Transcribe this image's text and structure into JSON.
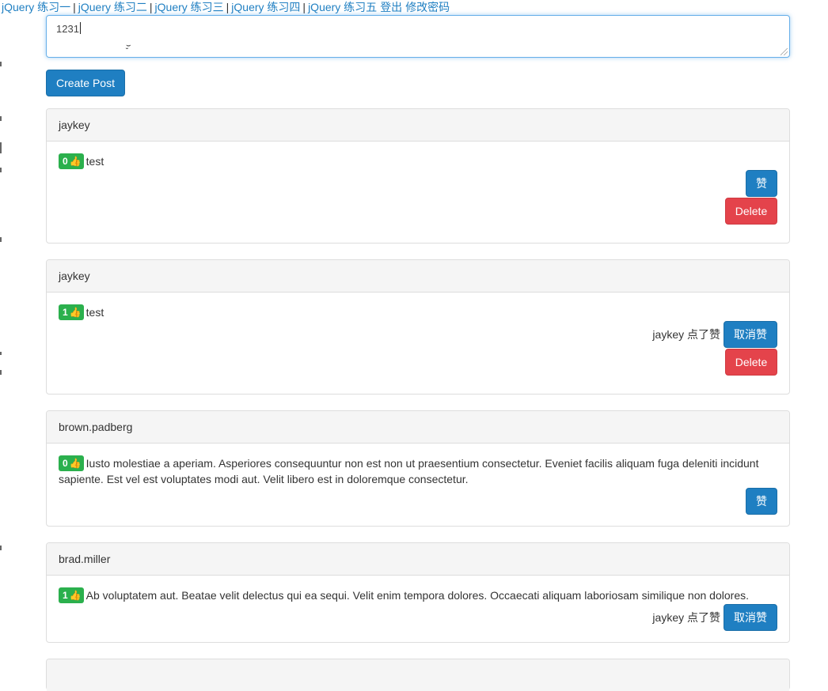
{
  "nav": {
    "links": [
      "jQuery 练习一",
      "jQuery 练习二",
      "jQuery 练习三",
      "jQuery 练习四",
      "jQuery 练习五"
    ],
    "logout": "登出",
    "change_password": "修改密码"
  },
  "composer": {
    "value": "1231"
  },
  "create_button": "Create Post",
  "posts": [
    {
      "author": "jaykey",
      "likes": "0",
      "body": "test",
      "like_label": "赞",
      "delete_label": "Delete"
    },
    {
      "author": "jaykey",
      "likes": "1",
      "body": "test",
      "liked_by": "jaykey 点了赞",
      "unlike_label": "取消赞",
      "delete_label": "Delete"
    },
    {
      "author": "brown.padberg",
      "likes": "0",
      "body": "Iusto molestiae a aperiam. Asperiores consequuntur non est non ut praesentium consectetur. Eveniet facilis aliquam fuga deleniti incidunt sapiente. Est vel est voluptates modi aut. Velit libero est in doloremque consectetur.",
      "like_label": "赞"
    },
    {
      "author": "brad.miller",
      "likes": "1",
      "body": "Ab voluptatem aut. Beatae velit delectus qui ea sequi. Velit enim tempora dolores. Occaecati aliquam laboriosam similique non dolores.",
      "liked_by": "jaykey 点了赞",
      "unlike_label": "取消赞"
    }
  ],
  "icons": {
    "thumb": "👍"
  },
  "colors": {
    "primary": "#1f7fc2",
    "danger": "#e4434b",
    "badge": "#2bb04d"
  }
}
